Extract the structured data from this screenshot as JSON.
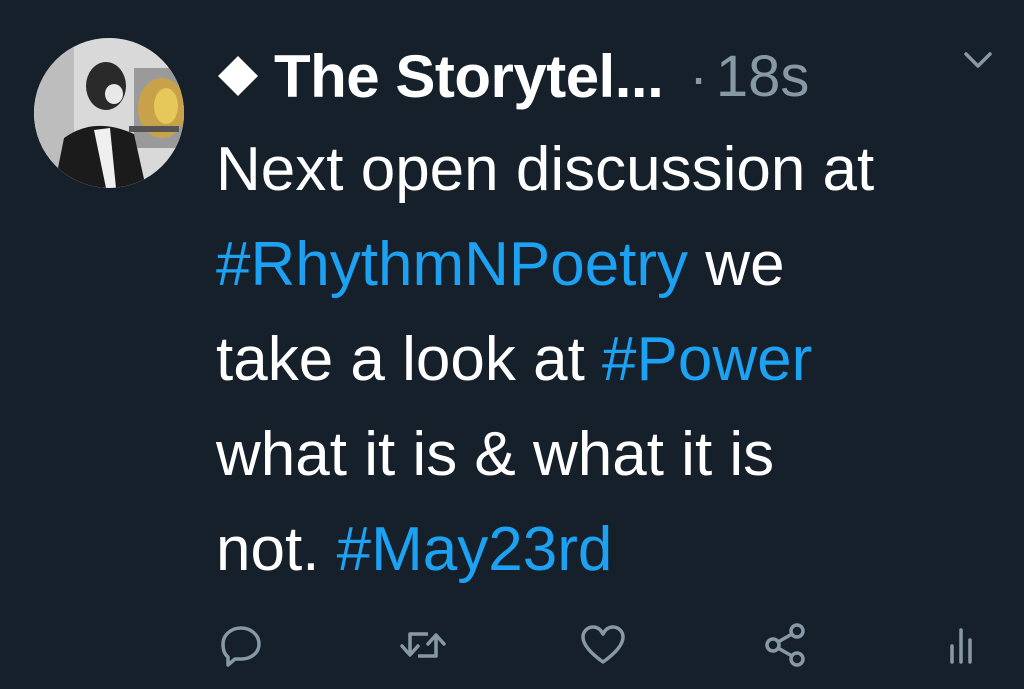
{
  "tweet": {
    "verified_symbol": "◆",
    "display_name": "The Storytel...",
    "separator": "·",
    "timestamp": "18s",
    "menu_icon": "chevron-down-icon",
    "avatar_icon": "profile-photo",
    "lines": [
      [
        {
          "text": "Next open discussion at",
          "hashtag": false
        }
      ],
      [
        {
          "text": "#RhythmNPoetry",
          "hashtag": true
        },
        {
          "text": " we",
          "hashtag": false
        }
      ],
      [
        {
          "text": "take a look at ",
          "hashtag": false
        },
        {
          "text": "#Power",
          "hashtag": true
        }
      ],
      [
        {
          "text": "what it is & what it is",
          "hashtag": false
        }
      ],
      [
        {
          "text": "not. ",
          "hashtag": false
        },
        {
          "text": "#May23rd",
          "hashtag": true
        }
      ]
    ],
    "actions": [
      {
        "name": "reply-icon"
      },
      {
        "name": "retweet-icon"
      },
      {
        "name": "like-icon"
      },
      {
        "name": "share-icon"
      },
      {
        "name": "analytics-icon"
      }
    ]
  },
  "colors": {
    "background": "#15202b",
    "text": "#ffffff",
    "secondary": "#8899a6",
    "hashtag": "#1da1f2"
  }
}
